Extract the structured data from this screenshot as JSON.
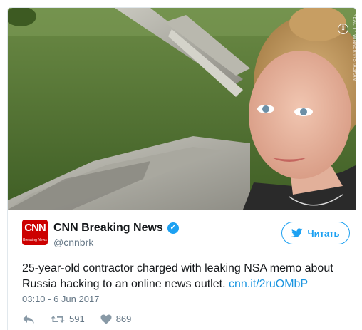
{
  "photo": {
    "info_icon": "info-icon",
    "credit": "REALITY WINNER/INSTAGRAM"
  },
  "tweet": {
    "author": {
      "display_name": "CNN Breaking News",
      "handle": "@cnnbrk",
      "verified": true,
      "avatar_text": "CNN",
      "avatar_sub": "Breaking News",
      "avatar_color": "#cc0000"
    },
    "follow_button": {
      "label": "Читать",
      "icon": "twitter-bird-icon"
    },
    "text": "25-year-old contractor charged with leaking NSA memo about Russia hacking to an online news outlet.",
    "link": "cnn.it/2ruOMbP",
    "timestamp": "03:10 - 6 Jun 2017",
    "actions": {
      "reply": {
        "icon": "reply-icon"
      },
      "retweet": {
        "icon": "retweet-icon",
        "count": "591"
      },
      "like": {
        "icon": "heart-icon",
        "count": "869"
      }
    }
  },
  "colors": {
    "accent": "#1da1f2",
    "link": "#1b95e0",
    "muted": "#657786",
    "border": "#e1e8ed"
  }
}
